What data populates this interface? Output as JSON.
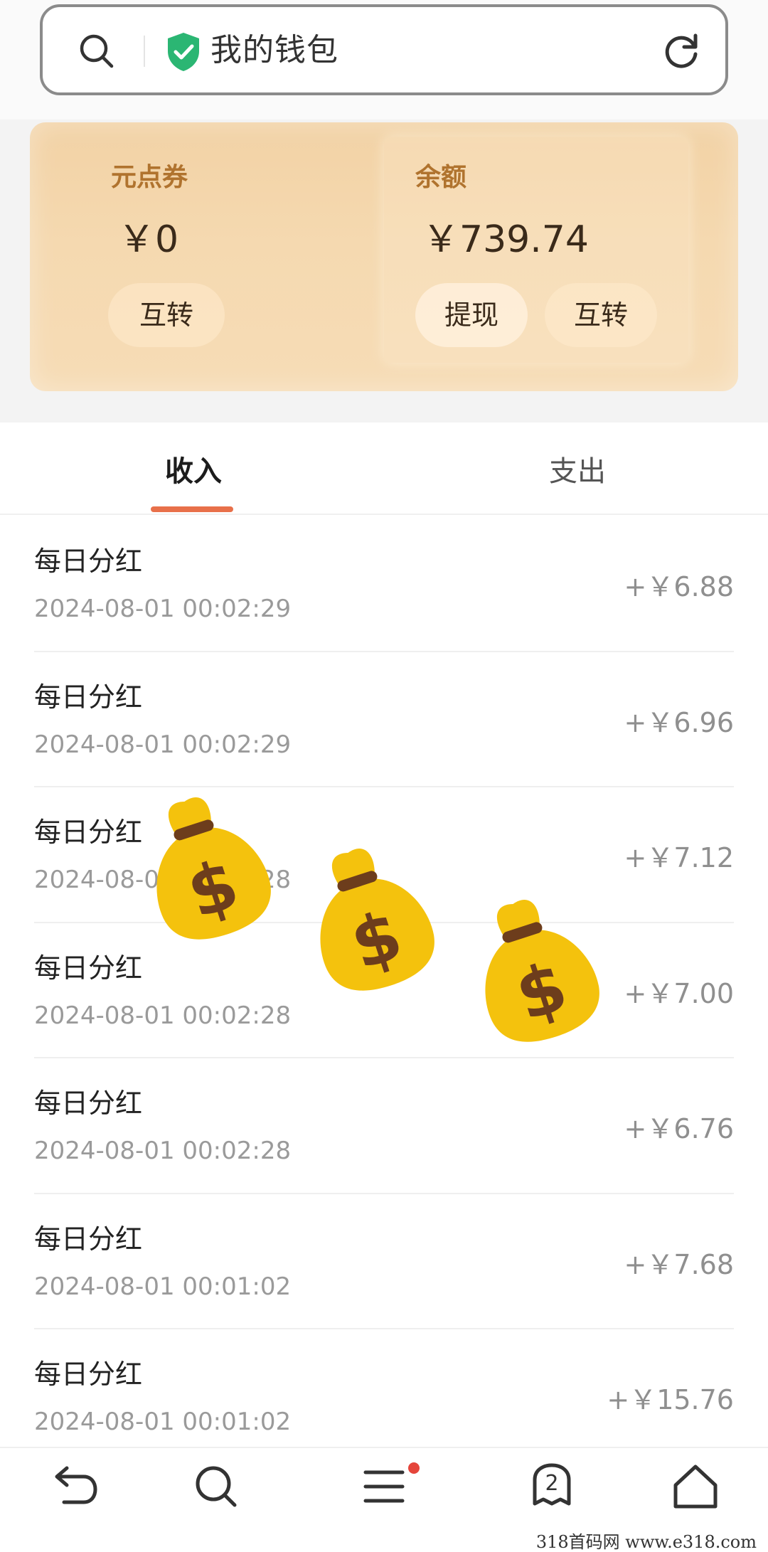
{
  "address_bar": {
    "title": "我的钱包"
  },
  "wallet": {
    "coupon": {
      "label": "元点券",
      "amount": "￥0",
      "transfer_label": "互转"
    },
    "balance": {
      "label": "余额",
      "amount": "￥739.74",
      "withdraw_label": "提现",
      "transfer_label": "互转"
    }
  },
  "tabs": {
    "income": "收入",
    "expense": "支出"
  },
  "transactions": [
    {
      "name": "每日分红",
      "time": "2024-08-01 00:02:29",
      "amount": "+￥6.88"
    },
    {
      "name": "每日分红",
      "time": "2024-08-01 00:02:29",
      "amount": "+￥6.96"
    },
    {
      "name": "每日分红",
      "time": "2024-08-01 00:02:28",
      "amount": "+￥7.12"
    },
    {
      "name": "每日分红",
      "time": "2024-08-01 00:02:28",
      "amount": "+￥7.00"
    },
    {
      "name": "每日分红",
      "time": "2024-08-01 00:02:28",
      "amount": "+￥6.76"
    },
    {
      "name": "每日分红",
      "time": "2024-08-01 00:01:02",
      "amount": "+￥7.68"
    },
    {
      "name": "每日分红",
      "time": "2024-08-01 00:01:02",
      "amount": "+￥15.76"
    }
  ],
  "bottom_nav": {
    "tabs_count": "2"
  },
  "watermark": "318首码网 www.e318.com",
  "colors": {
    "accent": "#e8704a",
    "card": "#f4d6ab",
    "label_brown": "#b0732e",
    "shield_green": "#2bb673",
    "bag_yellow": "#f4c20d",
    "bag_tie": "#6d3d1c"
  },
  "icons": [
    "search-icon",
    "shield-check-icon",
    "refresh-icon",
    "money-bag-icon",
    "back-icon",
    "menu-icon",
    "tabs-icon",
    "home-icon"
  ]
}
